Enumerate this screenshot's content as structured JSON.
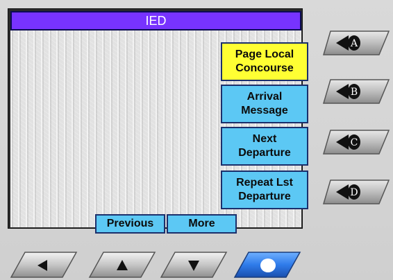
{
  "screen": {
    "title": "IED"
  },
  "options": [
    {
      "key": "A",
      "label": "Page Local\nConcourse",
      "selected": true
    },
    {
      "key": "B",
      "label": "Arrival\nMessage",
      "selected": false
    },
    {
      "key": "C",
      "label": "Next\nDeparture",
      "selected": false
    },
    {
      "key": "D",
      "label": "Repeat Lst\nDeparture",
      "selected": false
    }
  ],
  "nav": {
    "previous_label": "Previous",
    "more_label": "More"
  },
  "side_keys": [
    {
      "letter": "A",
      "icon": "left-pointer-A-icon"
    },
    {
      "letter": "B",
      "icon": "left-pointer-B-icon"
    },
    {
      "letter": "C",
      "icon": "left-pointer-C-icon"
    },
    {
      "letter": "D",
      "icon": "left-pointer-D-icon"
    }
  ],
  "bottom_keys": [
    {
      "icon": "left-arrow-icon"
    },
    {
      "icon": "up-arrow-icon"
    },
    {
      "icon": "down-arrow-icon"
    },
    {
      "icon": "select-dot-icon"
    }
  ],
  "colors": {
    "title_bar": "#7733ff",
    "option_button": "#5cc8f4",
    "option_selected": "#ffff33",
    "hardware_key": "#c0c0c0",
    "ok_key": "#2f7bea"
  }
}
